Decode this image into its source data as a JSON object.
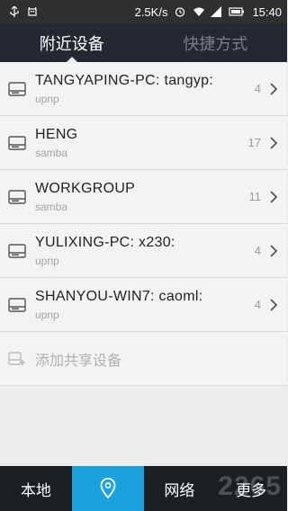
{
  "status_bar": {
    "speed": "2.5K/s",
    "time": "15:40",
    "icons": [
      "usb-icon",
      "android-debug-icon",
      "alarm-icon",
      "wifi-icon",
      "signal-icon",
      "battery-icon"
    ]
  },
  "tabs": [
    {
      "label": "附近设备",
      "active": true
    },
    {
      "label": "快捷方式",
      "active": false
    }
  ],
  "devices": [
    {
      "name": "TANGYAPING-PC: tangyp:",
      "protocol": "upnp",
      "count": "4"
    },
    {
      "name": "HENG",
      "protocol": "samba",
      "count": "17"
    },
    {
      "name": "WORKGROUP",
      "protocol": "samba",
      "count": "11"
    },
    {
      "name": "YULIXING-PC: x230:",
      "protocol": "upnp",
      "count": "4"
    },
    {
      "name": "SHANYOU-WIN7: caoml:",
      "protocol": "upnp",
      "count": "4"
    }
  ],
  "add_device_label": "添加共享设备",
  "bottom_nav": [
    {
      "label": "本地",
      "icon": null,
      "active": false
    },
    {
      "label": "",
      "icon": "location-pin-icon",
      "active": true
    },
    {
      "label": "网络",
      "icon": null,
      "active": false
    },
    {
      "label": "更多",
      "icon": null,
      "active": false
    }
  ],
  "watermark": "2265",
  "colors": {
    "accent": "#1aa3df",
    "tabbar_bg": "#242830",
    "bottombar_bg": "#1c1f24",
    "list_bg": "#f3f3f3"
  }
}
